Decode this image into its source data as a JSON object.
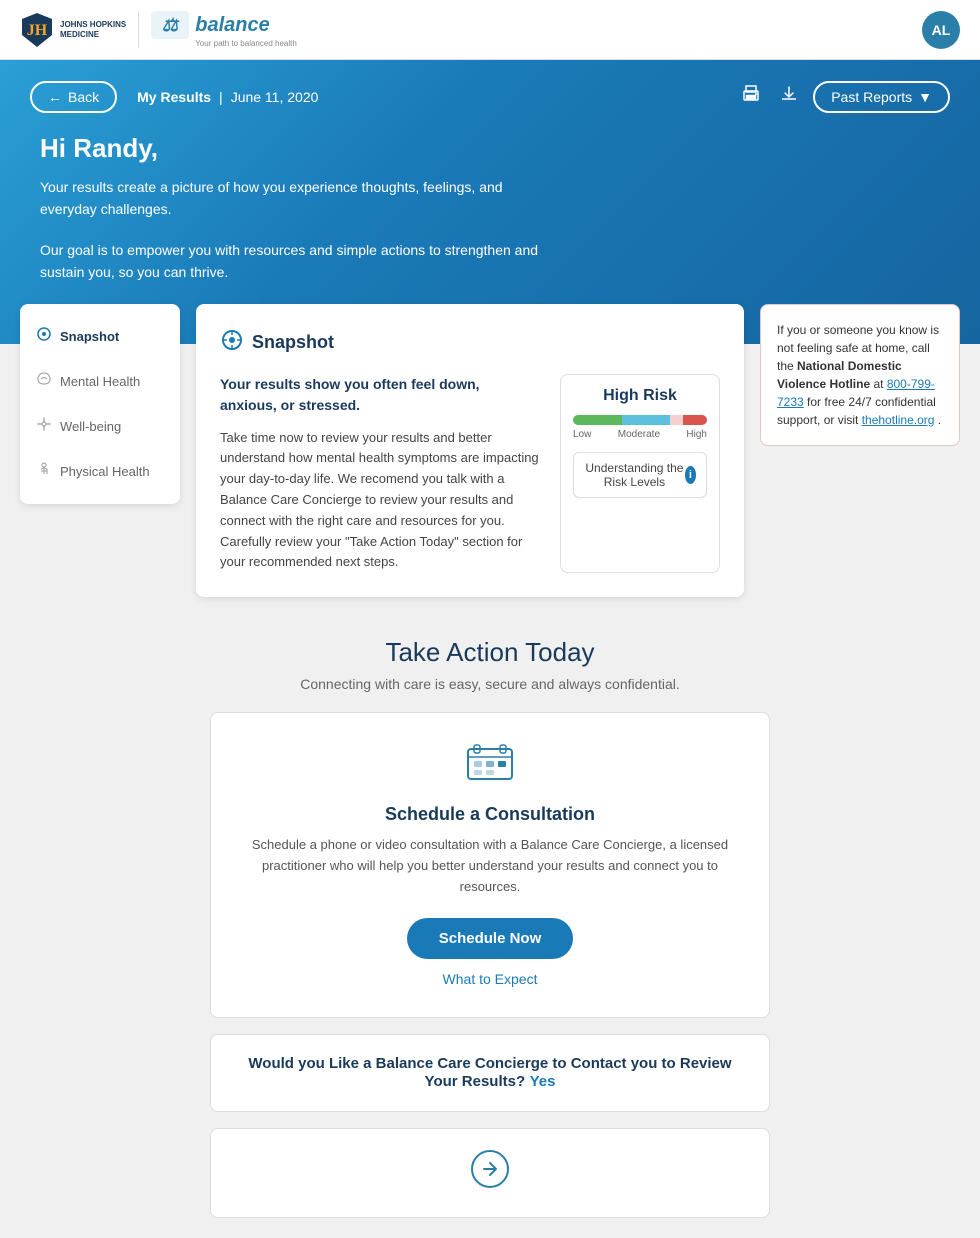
{
  "header": {
    "jh_logo_text": "JOHNS HOPKINS\nMEDICINE",
    "balance_logo_text": "balance",
    "balance_tagline": "Your path to balanced health",
    "avatar_initials": "AL"
  },
  "nav": {
    "back_label": "Back",
    "my_results_label": "My Results",
    "date_label": "June 11, 2020",
    "past_reports_label": "Past Reports"
  },
  "hero": {
    "greeting": "Hi Randy,",
    "desc1": "Your results create a picture of how you experience thoughts, feelings, and everyday challenges.",
    "desc2": "Our goal is to empower you with resources and simple actions to strengthen and sustain you, so you can thrive."
  },
  "sidebar": {
    "items": [
      {
        "id": "snapshot",
        "label": "Snapshot",
        "icon": "⊙",
        "active": true
      },
      {
        "id": "mental-health",
        "label": "Mental Health",
        "icon": "🌿",
        "active": false
      },
      {
        "id": "well-being",
        "label": "Well-being",
        "icon": "✦",
        "active": false
      },
      {
        "id": "physical-health",
        "label": "Physical Health",
        "icon": "🤚",
        "active": false
      }
    ]
  },
  "snapshot": {
    "title": "Snapshot",
    "summary": "Your results show you often feel down, anxious, or stressed.",
    "desc": "Take time now to review your results and better understand how mental health symptoms are impacting your  day-to-day life. We recomend you talk with a Balance Care Concierge to review your results and connect with the right care and resources for you. Carefully review your \"Take Action Today\" section for your recommended next steps.",
    "risk": {
      "label": "High Risk",
      "bar_labels": [
        "Low",
        "Moderate",
        "High"
      ]
    },
    "understanding_label": "Understanding the Risk Levels",
    "info_icon": "i"
  },
  "alert": {
    "text_pre": "If you or someone you know is not feeling safe at home, call the ",
    "hotline_name": "National Domestic Violence Hotline",
    "text_mid": " at ",
    "phone": "800-799-7233",
    "text_post": " for free 24/7 confidential support, or visit ",
    "link": "thehotline.org",
    "link_url": "https://www.thehotline.org"
  },
  "take_action": {
    "title": "Take Action Today",
    "subtitle": "Connecting with care is easy, secure and always confidential.",
    "consultation": {
      "title": "Schedule a Consultation",
      "desc": "Schedule a phone or video consultation with a Balance Care Concierge, a licensed practitioner who will help you better understand your results and connect you to resources.",
      "button_label": "Schedule Now",
      "link_label": "What to Expect"
    },
    "contact": {
      "text": "Would you Like a Balance Care Concierge to Contact you to Review Your Results?",
      "yes_label": "Yes"
    }
  }
}
